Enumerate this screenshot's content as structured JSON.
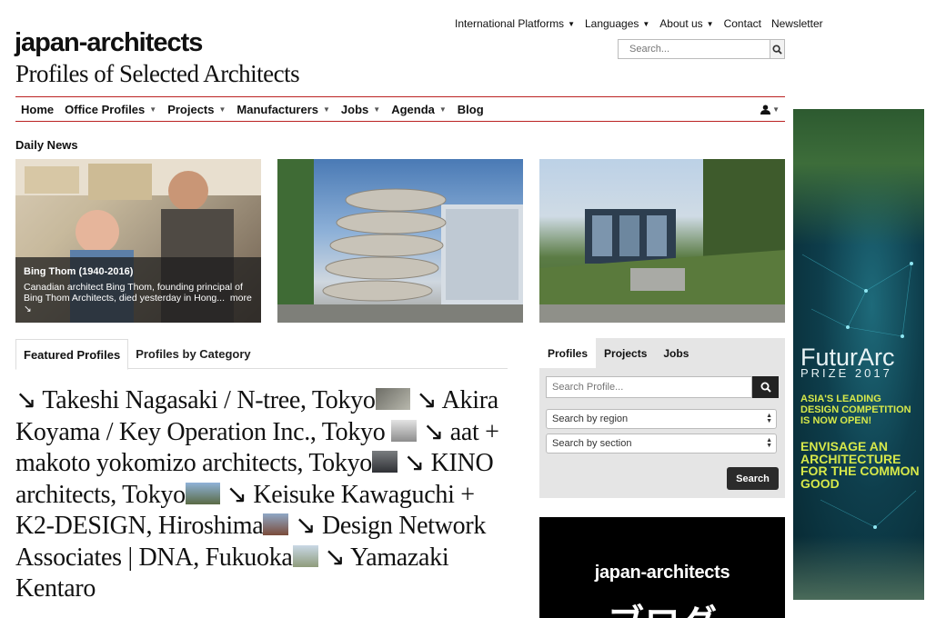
{
  "top_nav": {
    "items": [
      {
        "label": "International Platforms",
        "dropdown": true
      },
      {
        "label": "Languages",
        "dropdown": true
      },
      {
        "label": "About us",
        "dropdown": true
      },
      {
        "label": "Contact",
        "dropdown": false
      },
      {
        "label": "Newsletter",
        "dropdown": false
      }
    ]
  },
  "search": {
    "placeholder": "Search..."
  },
  "site": {
    "logo": "japan-architects",
    "tagline": "Profiles of Selected Architects"
  },
  "main_nav": {
    "items": [
      {
        "label": "Home",
        "dropdown": false
      },
      {
        "label": "Office Profiles",
        "dropdown": true
      },
      {
        "label": "Projects",
        "dropdown": true
      },
      {
        "label": "Manufacturers",
        "dropdown": true
      },
      {
        "label": "Jobs",
        "dropdown": true
      },
      {
        "label": "Agenda",
        "dropdown": true
      },
      {
        "label": "Blog",
        "dropdown": false
      }
    ]
  },
  "daily_news": {
    "heading": "Daily News",
    "items": [
      {
        "title": "Bing Thom (1940-2016)",
        "description": "Canadian architect Bing Thom, founding principal of Bing Thom Architects, died yesterday in Hong...",
        "more": "more ↘"
      }
    ]
  },
  "profile_tabs": [
    {
      "label": "Featured Profiles",
      "active": true
    },
    {
      "label": "Profiles by Category",
      "active": false
    }
  ],
  "featured_profiles": [
    {
      "arrow": "↘",
      "name": "Takeshi Nagasaki / N-tree, Tokyo"
    },
    {
      "arrow": "↘",
      "name": "Akira Koyama / Key Operation Inc., Tokyo"
    },
    {
      "arrow": "↘",
      "name": "aat + makoto yokomizo architects, Tokyo"
    },
    {
      "arrow": "↘",
      "name": "KINO architects, Tokyo"
    },
    {
      "arrow": "↘",
      "name": "Keisuke Kawaguchi + K2-DESIGN, Hiroshima"
    },
    {
      "arrow": "↘",
      "name": "Design Network Associates | DNA, Fukuoka"
    },
    {
      "arrow": "↘",
      "name": "Yamazaki Kentaro"
    }
  ],
  "profile_widget": {
    "tabs": [
      {
        "label": "Profiles",
        "active": true
      },
      {
        "label": "Projects",
        "active": false
      },
      {
        "label": "Jobs",
        "active": false
      }
    ],
    "search_placeholder": "Search Profile...",
    "region_select": "Search by region",
    "section_select": "Search by section",
    "search_button": "Search"
  },
  "blog_banner": {
    "title": "japan-architects",
    "japanese": "ブログ"
  },
  "ad": {
    "brand": "FuturArc",
    "prize": "PRIZE 2017",
    "headline": "ASIA'S LEADING DESIGN COMPETITION IS NOW OPEN!",
    "slogan": "ENVISAGE AN ARCHITECTURE FOR THE COMMON GOOD"
  }
}
